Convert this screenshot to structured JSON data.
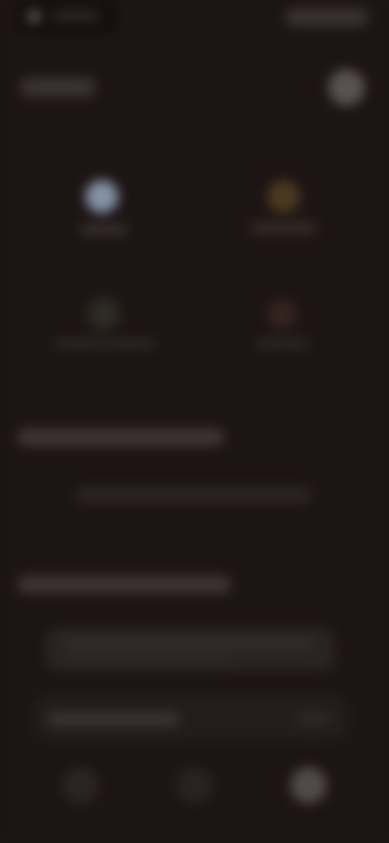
{
  "statusbar": {
    "time": "",
    "icons": "status-icons"
  },
  "header": {
    "title": "",
    "avatar_icon": "avatar-icon"
  },
  "quick_tiles": [
    {
      "label": "",
      "icon": "tile-icon-1"
    },
    {
      "label": "",
      "icon": "tile-icon-2"
    },
    {
      "label": "",
      "icon": "tile-icon-3"
    },
    {
      "label": "",
      "icon": "tile-icon-4"
    }
  ],
  "section1": {
    "title": "",
    "row_text": ""
  },
  "section2": {
    "title": "",
    "card": {
      "line1": "",
      "line2": ""
    },
    "banner": {
      "label": ""
    }
  },
  "bottom_nav": [
    {
      "icon": "nav-icon-1"
    },
    {
      "icon": "nav-icon-2"
    },
    {
      "icon": "nav-icon-3"
    }
  ],
  "colors": {
    "background": "#1d1414",
    "accent_tile_1": "#8492a8",
    "accent_tile_2": "#4a3a20"
  }
}
